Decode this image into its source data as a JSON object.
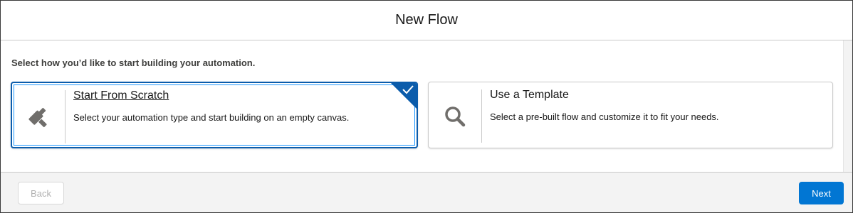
{
  "header": {
    "title": "New Flow"
  },
  "instruction": "Select how you’d like to start building your automation.",
  "options": [
    {
      "title": "Start From Scratch",
      "description": "Select your automation type and start building on an empty canvas.",
      "icon": "hammer-icon",
      "selected": true
    },
    {
      "title": "Use a Template",
      "description": "Select a pre-built flow and customize it to fit your needs.",
      "icon": "search-icon",
      "selected": false
    }
  ],
  "footer": {
    "back_label": "Back",
    "back_disabled": true,
    "next_label": "Next"
  },
  "colors": {
    "accent": "#0176d3",
    "selected_border": "#0b5cab",
    "icon_gray": "#706e6b"
  }
}
